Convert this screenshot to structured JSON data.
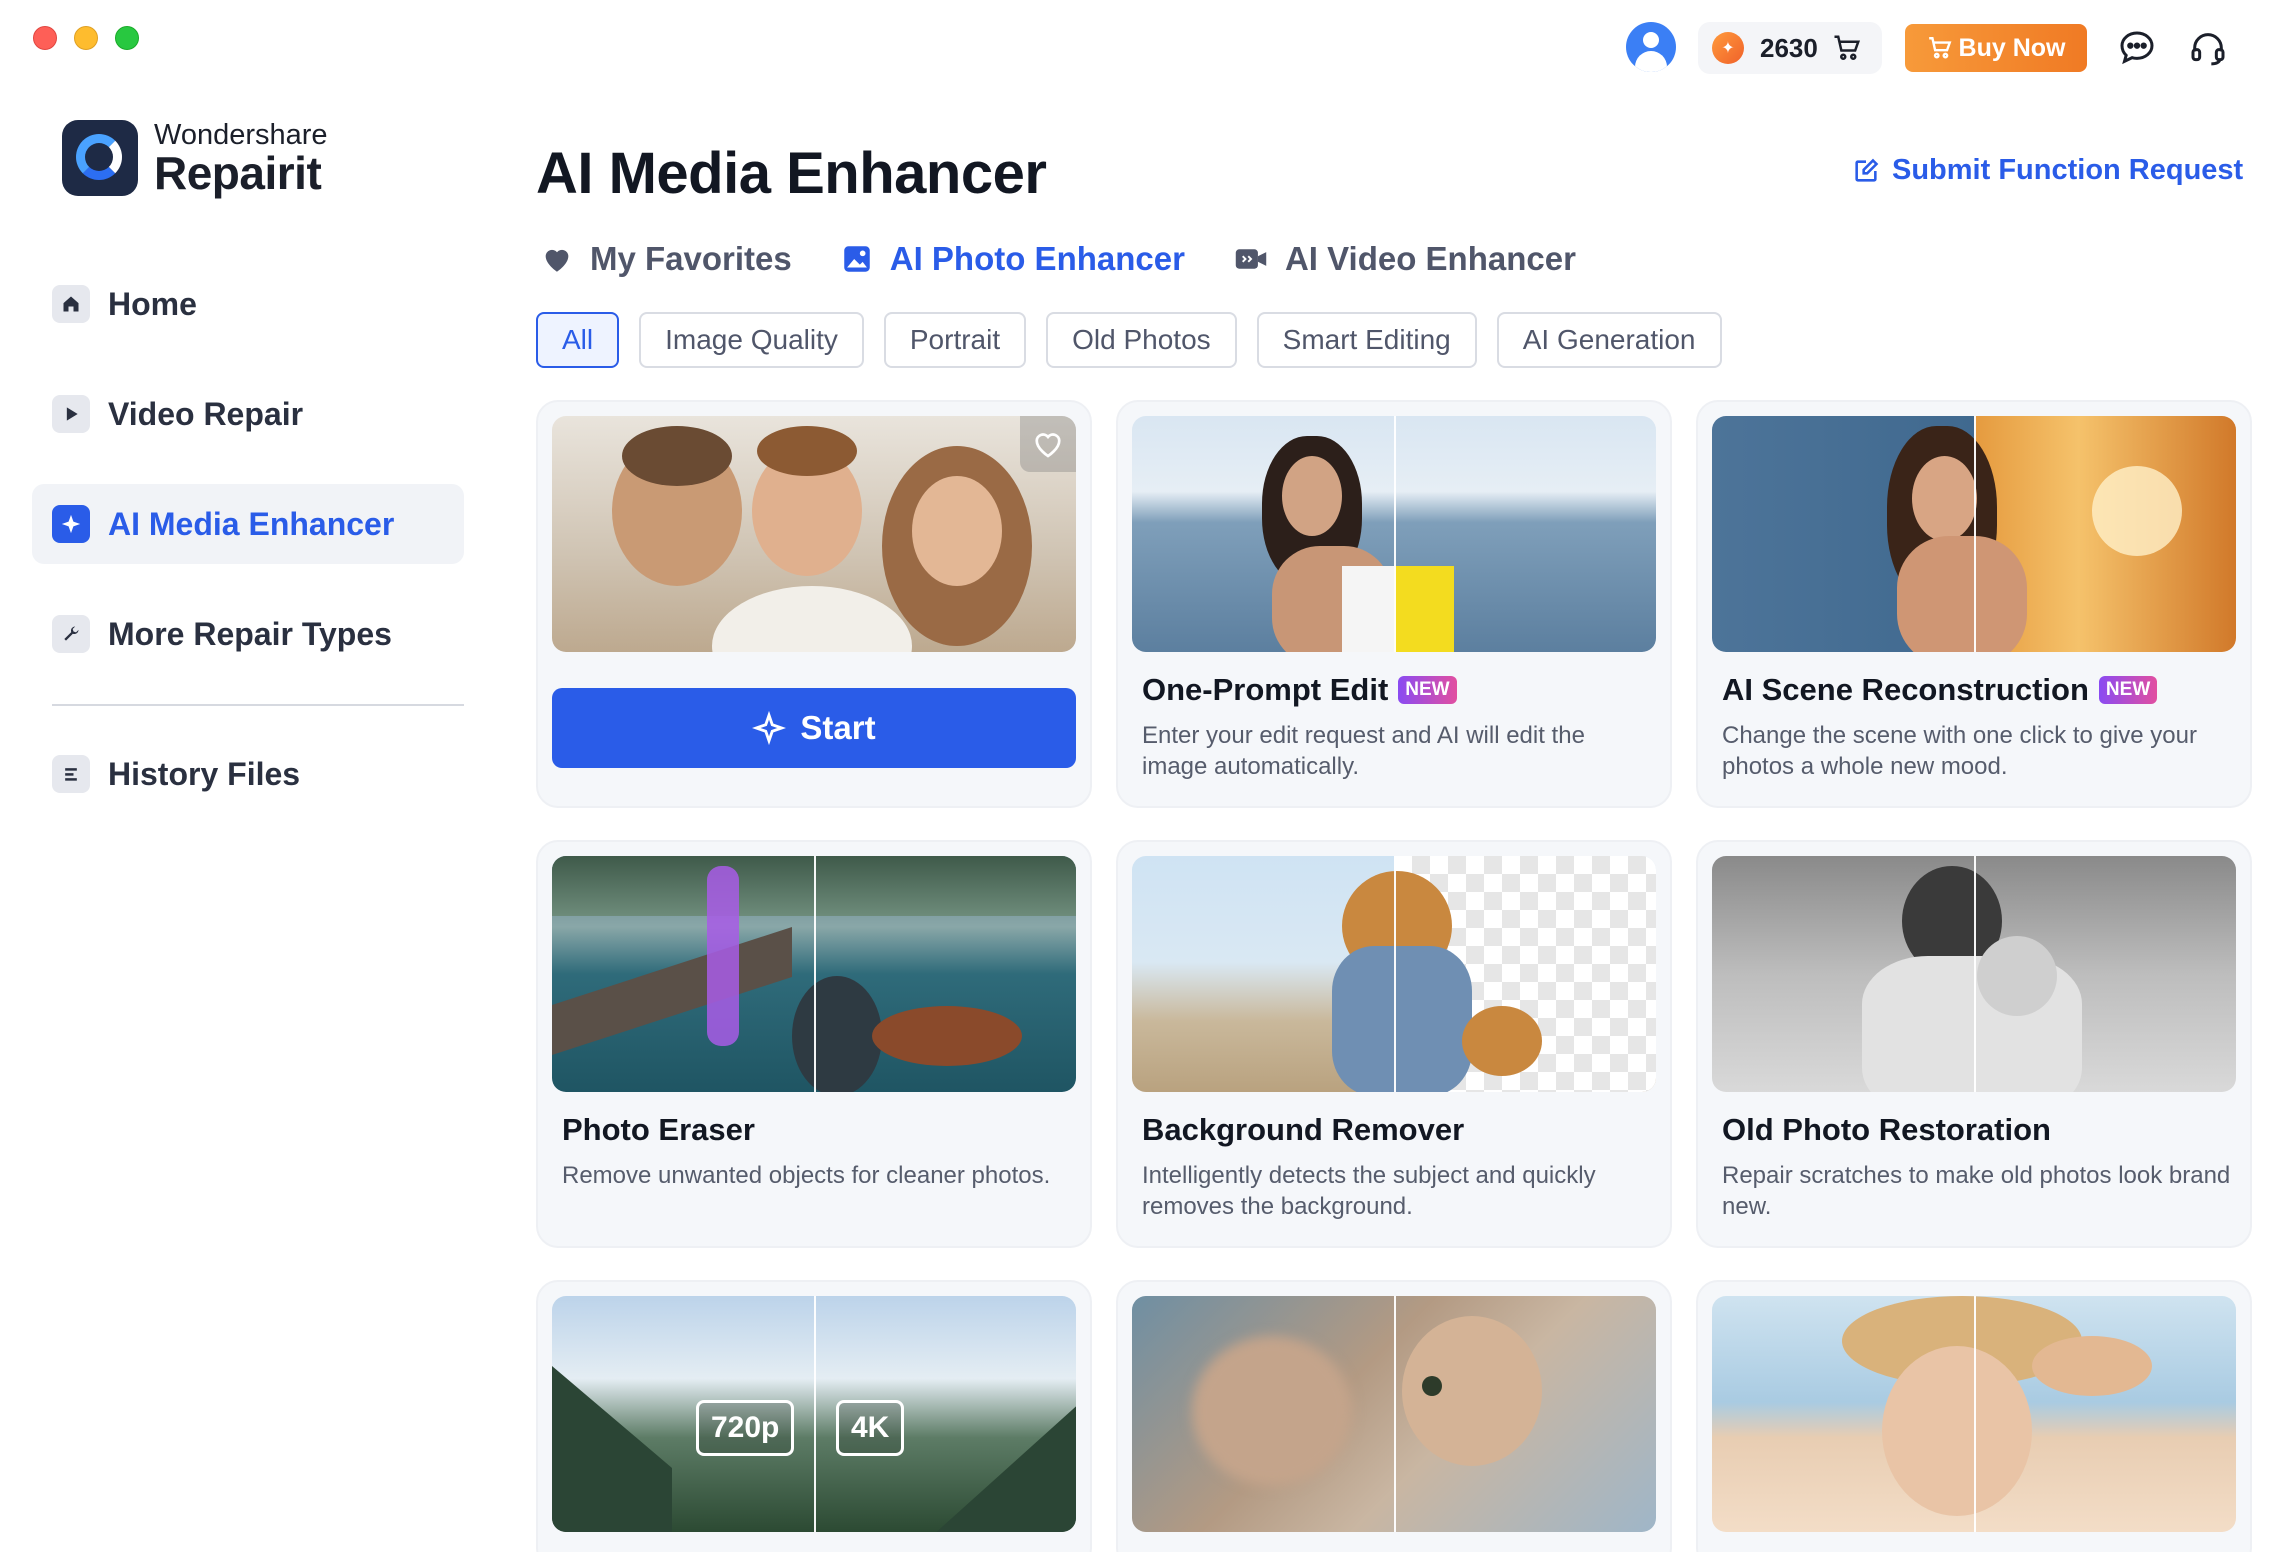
{
  "window": {
    "title": "Wondershare Repairit"
  },
  "topbar": {
    "credits": "2630",
    "buy_now": "Buy Now"
  },
  "logo": {
    "brand": "Wondershare",
    "product": "Repairit"
  },
  "sidebar": {
    "items": [
      {
        "label": "Home",
        "icon": "home-icon"
      },
      {
        "label": "Video Repair",
        "icon": "play-icon"
      },
      {
        "label": "AI Media Enhancer",
        "icon": "sparkle-icon",
        "active": true
      },
      {
        "label": "More Repair Types",
        "icon": "wrench-icon"
      },
      {
        "label": "History Files",
        "icon": "list-icon"
      }
    ]
  },
  "main": {
    "title": "AI Media Enhancer",
    "submit_request": "Submit Function Request",
    "tabs": [
      {
        "label": "My Favorites",
        "icon": "heart-icon"
      },
      {
        "label": "AI Photo Enhancer",
        "icon": "image-icon",
        "active": true
      },
      {
        "label": "AI Video Enhancer",
        "icon": "video-icon"
      }
    ],
    "filters": [
      "All",
      "Image Quality",
      "Portrait",
      "Old Photos",
      "Smart Editing",
      "AI Generation"
    ],
    "active_filter": "All",
    "start_label": "Start",
    "new_badge": "NEW",
    "cards": [
      {
        "title": "One-Prompt Edit",
        "desc": "Enter your edit request and AI will edit the image automatically.",
        "new": true
      },
      {
        "title": "AI Scene Reconstruction",
        "desc": "Change the scene with one click to give your photos a whole new mood.",
        "new": true
      },
      {
        "title": "Photo Eraser",
        "desc": "Remove unwanted objects for cleaner photos."
      },
      {
        "title": "Background Remover",
        "desc": "Intelligently detects the subject and quickly removes the background."
      },
      {
        "title": "Old Photo Restoration",
        "desc": "Repair scratches to make old photos look brand new."
      }
    ],
    "resolution_tags": {
      "before": "720p",
      "after": "4K"
    }
  },
  "colors": {
    "accent": "#2a5ce8",
    "buy_now": "#f07a24",
    "new_badge": "#8a4bf2"
  }
}
